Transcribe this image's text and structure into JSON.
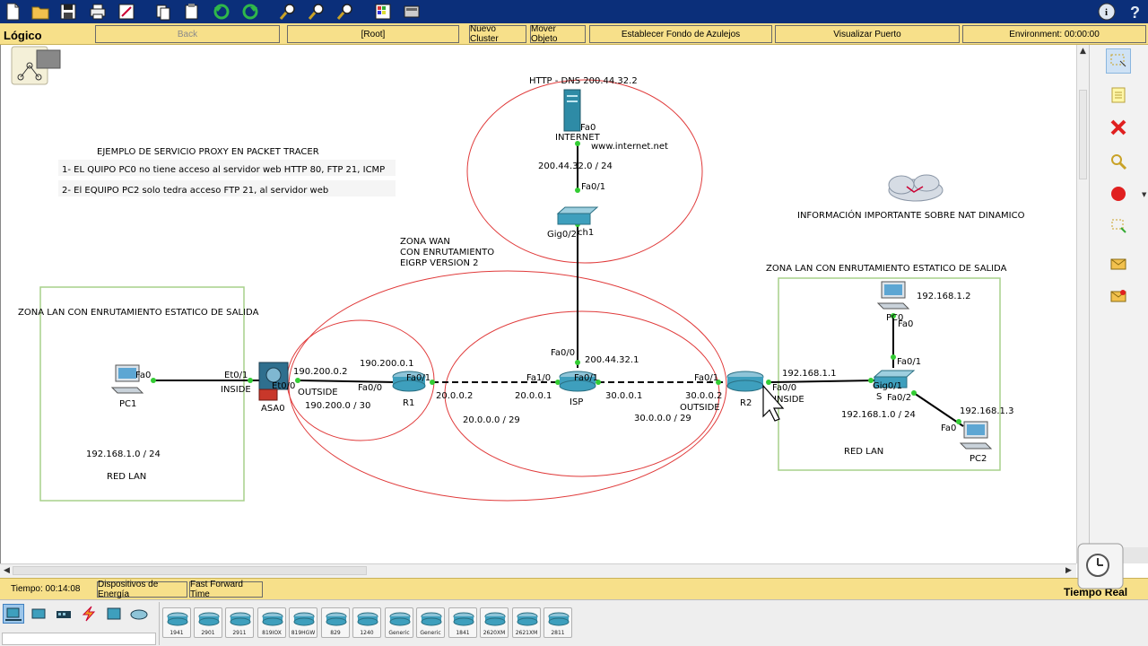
{
  "app": {
    "title_mode": "Lógico",
    "accent_color": "#f7e08a",
    "toolbar_color": "#0b2f7a"
  },
  "toolbar": {
    "icons": [
      "new-file-icon",
      "open-folder-icon",
      "save-icon",
      "print-icon",
      "activity-wizard-icon",
      "copy-icon",
      "paste-icon",
      "undo-icon",
      "redo-icon",
      "zoom-in-icon",
      "zoom-reset-icon",
      "zoom-out-icon",
      "palette-icon",
      "custom-device-icon",
      "info-icon",
      "help-icon"
    ]
  },
  "nav": {
    "back": "Back",
    "root": "[Root]",
    "new_cluster": "Nuevo Cluster",
    "move_object": "Mover Objeto",
    "set_background": "Establecer Fondo de Azulejos",
    "view_port": "Visualizar Puerto",
    "environment": "Environment: 00:00:00"
  },
  "canvas": {
    "notes": {
      "title": "EJEMPLO DE SERVICIO PROXY EN PACKET TRACER",
      "line1": "1- EL QUIPO PC0 no tiene acceso al servidor web HTTP 80, FTP 21, ICMP",
      "line2": "2- El EQUIPO PC2 solo tedra acceso FTP 21, al servidor web"
    },
    "server_title": "HTTP - DNS 200.44.32.2",
    "server_name": "INTERNET",
    "server_port": "Fa0",
    "server_url": "www.internet.net",
    "net_server": "200.44.32.0 / 24",
    "switch_top_port_up": "Fa0/1",
    "switch_top_name": "Gig0/2",
    "switch_top_name2": "ch1",
    "wan_zone_l1": "ZONA WAN",
    "wan_zone_l2": "CON ENRUTAMIENTO",
    "wan_zone_l3": "EIGRP VERSION 2",
    "nat_cloud_label": "INFORMACIÓN IMPORTANTE SOBRE NAT DINAMICO",
    "left_zone_title": "ZONA LAN CON ENRUTAMIENTO ESTATICO DE SALIDA",
    "left_net": "192.168.1.0 / 24",
    "left_lan": "RED LAN",
    "pc1_name": "PC1",
    "pc1_port": "Fa0",
    "asa_port_in": "Et0/1",
    "asa_inside": "INSIDE",
    "asa_name": "ASA0",
    "asa_port_out": "Et0/0",
    "asa_ip": "190.200.0.2",
    "asa_outside": "OUTSIDE",
    "net_asa_r1": "190.200.0 / 30",
    "r1_ip": "190.200.0.1",
    "r1_port_in": "Fa0/0",
    "r1_port_out": "Fa0/1",
    "r1_name": "R1",
    "r1_wan_ip": "20.0.0.2",
    "isp_port_left": "Fa1/0",
    "isp_ip_left": "20.0.0.1",
    "isp_port_up": "Fa0/0",
    "isp_ip_up": "200.44.32.1",
    "isp_port_right": "Fa0/1",
    "isp_ip_right": "30.0.0.1",
    "isp_name": "ISP",
    "net_r1_isp": "20.0.0.0 / 29",
    "net_isp_r2": "30.0.0.0 / 29",
    "r2_port_left": "Fa0/1",
    "r2_ip_left": "30.0.0.2",
    "r2_outside": "OUTSIDE",
    "r2_name": "R2",
    "r2_port_right": "Fa0/0",
    "r2_ip_right": "192.168.1.1",
    "r2_inside": "INSIDE",
    "right_zone_title": "ZONA LAN CON ENRUTAMIENTO ESTATICO DE SALIDA",
    "pc0_ip": "192.168.1.2",
    "pc0_name": "PC0",
    "pc0_port": "Fa0",
    "sw_port_up": "Fa0/1",
    "sw_port_left": "Gig0/1",
    "sw_port_down": "Fa0/2",
    "sw_name": "S",
    "right_net": "192.168.1.0 / 24",
    "pc2_ip": "192.168.1.3",
    "pc2_port": "Fa0",
    "pc2_name": "PC2",
    "right_lan": "RED LAN"
  },
  "rightpanel": {
    "tools": [
      "select-icon",
      "note-icon",
      "delete-icon",
      "inspect-icon",
      "draw-shape-icon",
      "resize-icon",
      "simple-pdu-icon",
      "complex-pdu-icon"
    ]
  },
  "status": {
    "time": "Tiempo: 00:14:08",
    "power_cycle": "Dispositivos de Energía",
    "fast_forward": "Fast Forward Time",
    "realtime": "Tiempo Real"
  },
  "devices": {
    "categories": [
      "end-devices-icon",
      "switches-icon",
      "hubs-icon",
      "connections-icon",
      "multiuser-icon",
      "wan-emulation-icon"
    ],
    "routers": [
      "1941",
      "2901",
      "2911",
      "819IOX",
      "819HGW",
      "829",
      "1240",
      "Generic",
      "Generic",
      "1841",
      "2620XM",
      "2621XM",
      "2811"
    ]
  }
}
